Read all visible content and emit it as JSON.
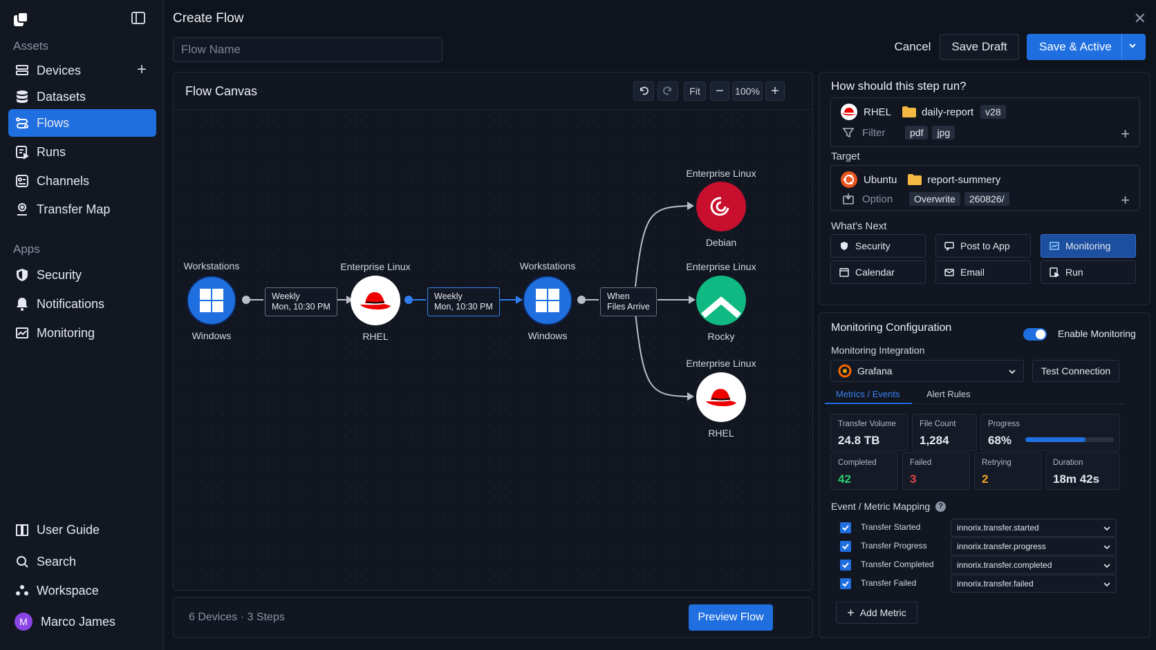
{
  "sidebar": {
    "assets_label": "Assets",
    "apps_label": "Apps",
    "items": [
      {
        "label": "Devices"
      },
      {
        "label": "Datasets"
      },
      {
        "label": "Flows"
      },
      {
        "label": "Runs"
      },
      {
        "label": "Channels"
      },
      {
        "label": "Transfer Map"
      },
      {
        "label": "Security"
      },
      {
        "label": "Notifications"
      },
      {
        "label": "Monitoring"
      },
      {
        "label": "User Guide"
      },
      {
        "label": "Search"
      },
      {
        "label": "Workspace"
      }
    ],
    "user": {
      "initial": "M",
      "name": "Marco James"
    }
  },
  "header": {
    "title": "Create Flow",
    "flow_name_placeholder": "Flow Name",
    "cancel": "Cancel",
    "save_draft": "Save Draft",
    "save_active": "Save & Active"
  },
  "canvas": {
    "title": "Flow Canvas",
    "fit": "Fit",
    "zoom": "100%",
    "nodes": [
      {
        "top": "Workstations",
        "bottom": "Windows"
      },
      {
        "top": "Enterprise Linux",
        "bottom": "RHEL"
      },
      {
        "top": "Workstations",
        "bottom": "Windows"
      },
      {
        "top": "Enterprise Linux",
        "bottom": "Debian"
      },
      {
        "top": "Enterprise Linux",
        "bottom": "Rocky"
      },
      {
        "top": "Enterprise Linux",
        "bottom": "RHEL"
      }
    ],
    "edges": [
      {
        "line1": "Weekly",
        "line2": "Mon, 10:30 PM"
      },
      {
        "line1": "Weekly",
        "line2": "Mon, 10:30 PM"
      },
      {
        "line1": "When",
        "line2": "Files Arrive"
      }
    ],
    "footer": "6 Devices · 3 Steps",
    "preview": "Preview Flow"
  },
  "step": {
    "title": "How should this step run?",
    "source": {
      "os": "RHEL",
      "folder": "daily-report",
      "version": "v28",
      "filter_label": "Filter",
      "filters": [
        "pdf",
        "jpg"
      ]
    },
    "target_label": "Target",
    "target": {
      "os": "Ubuntu",
      "folder": "report-summery",
      "option_label": "Option",
      "option_value": "Overwrite",
      "path": "260826/"
    },
    "next_label": "What's Next",
    "next": [
      "Security",
      "Post to App",
      "Monitoring",
      "Calendar",
      "Email",
      "Run"
    ]
  },
  "monitoring": {
    "title": "Monitoring Configuration",
    "enable_label": "Enable Monitoring",
    "enabled": true,
    "integration_label": "Monitoring Integration",
    "integration": "Grafana",
    "test": "Test Connection",
    "tabs": [
      "Metrics / Events",
      "Alert Rules"
    ],
    "stats": {
      "transfer_volume": {
        "label": "Transfer Volume",
        "value": "24.8 TB"
      },
      "file_count": {
        "label": "File Count",
        "value": "1,284"
      },
      "progress": {
        "label": "Progress",
        "value": "68%",
        "fraction": 0.68
      },
      "completed": {
        "label": "Completed",
        "value": "42"
      },
      "failed": {
        "label": "Failed",
        "value": "3"
      },
      "retrying": {
        "label": "Retrying",
        "value": "2"
      },
      "duration": {
        "label": "Duration",
        "value": "18m 42s"
      }
    },
    "mapping_label": "Event / Metric Mapping",
    "mappings": [
      {
        "event": "Transfer Started",
        "metric": "innorix.transfer.started"
      },
      {
        "event": "Transfer Progress",
        "metric": "innorix.transfer.progress"
      },
      {
        "event": "Transfer Completed",
        "metric": "innorix.transfer.completed"
      },
      {
        "event": "Transfer Failed",
        "metric": "innorix.transfer.failed"
      }
    ],
    "add_metric": "Add Metric"
  },
  "colors": {
    "accent": "#1f6fe0",
    "success": "#2ecc71",
    "danger": "#e5484d",
    "warning": "#f5a524"
  }
}
